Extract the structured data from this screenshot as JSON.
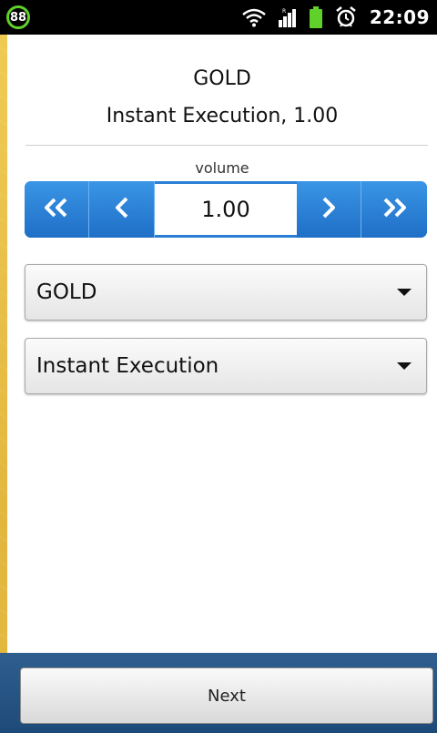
{
  "status_bar": {
    "battery_level": "88",
    "time": "22:09",
    "icons": [
      "wifi-icon",
      "signal-icon",
      "battery-icon",
      "alarm-icon"
    ],
    "battery_color": "#5fd12a"
  },
  "header": {
    "title": "GOLD",
    "subtitle": "Instant Execution, 1.00"
  },
  "volume": {
    "label": "volume",
    "value": "1.00",
    "buttons": [
      "double-chevron-left-icon",
      "chevron-left-icon",
      "chevron-right-icon",
      "double-chevron-right-icon"
    ],
    "accent": "#2a7fd4"
  },
  "symbol_select": {
    "value": "GOLD"
  },
  "execution_select": {
    "value": "Instant Execution"
  },
  "footer": {
    "next_label": "Next"
  }
}
